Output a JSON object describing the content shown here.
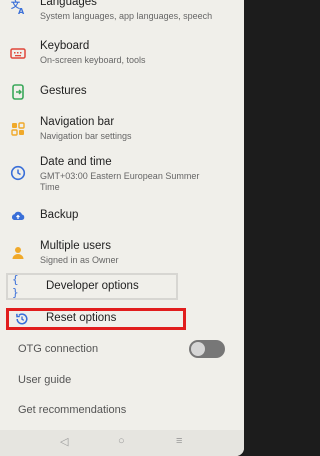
{
  "settings": {
    "languages": {
      "title": "Languages",
      "subtitle": "System languages, app languages, speech",
      "icon": "translate-icon"
    },
    "keyboard": {
      "title": "Keyboard",
      "subtitle": "On-screen keyboard, tools",
      "icon": "keyboard-icon"
    },
    "gestures": {
      "title": "Gestures",
      "icon": "gestures-icon"
    },
    "navigation_bar": {
      "title": "Navigation bar",
      "subtitle": "Navigation bar settings",
      "icon": "navigation-bar-icon"
    },
    "date_time": {
      "title": "Date and time",
      "subtitle_line1": "GMT+03:00 Eastern European Summer",
      "subtitle_line2": "Time",
      "icon": "clock-icon"
    },
    "backup": {
      "title": "Backup",
      "icon": "cloud-backup-icon"
    },
    "multiple_users": {
      "title": "Multiple users",
      "subtitle": "Signed in as Owner",
      "icon": "users-icon"
    },
    "developer_options": {
      "title": "Developer options",
      "icon_text": "{ }"
    },
    "reset_options": {
      "title": "Reset options",
      "icon": "reset-history-icon"
    },
    "otg_connection": {
      "title": "OTG connection",
      "toggle_on": false
    },
    "user_guide": {
      "title": "User guide"
    },
    "get_recommendations": {
      "title": "Get recommendations"
    }
  },
  "navbar": {
    "back": "◁",
    "home": "○",
    "recents": "≡"
  },
  "colors": {
    "highlight": "#e11d1d",
    "icon_blue": "#3a6fd8",
    "icon_red": "#e0473a",
    "icon_green": "#3aa85a",
    "icon_amber": "#f0a92a"
  }
}
